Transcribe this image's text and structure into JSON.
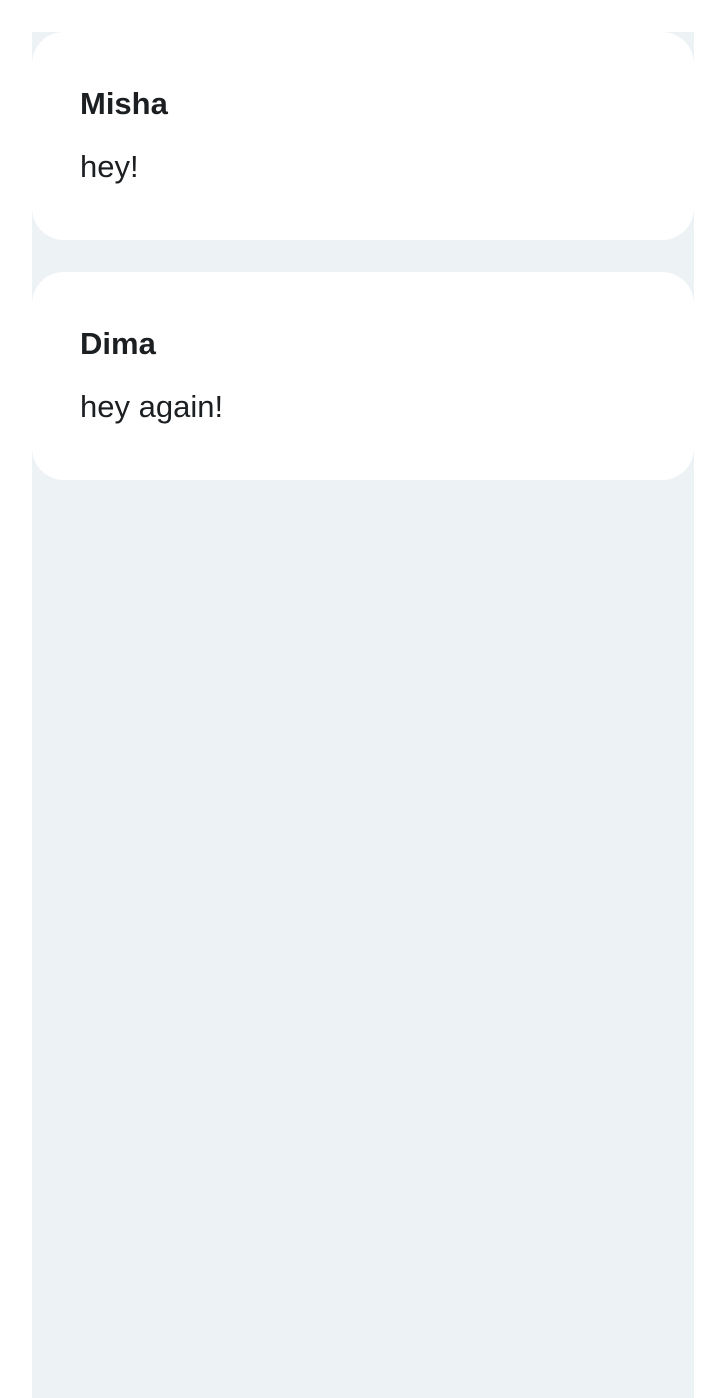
{
  "colors": {
    "page_background": "#ffffff",
    "feed_background": "#edf2f5",
    "card_background": "#ffffff",
    "text": "#1c1f22"
  },
  "messages": [
    {
      "author": "Misha",
      "text": "hey!"
    },
    {
      "author": "Dima",
      "text": "hey again!"
    }
  ]
}
